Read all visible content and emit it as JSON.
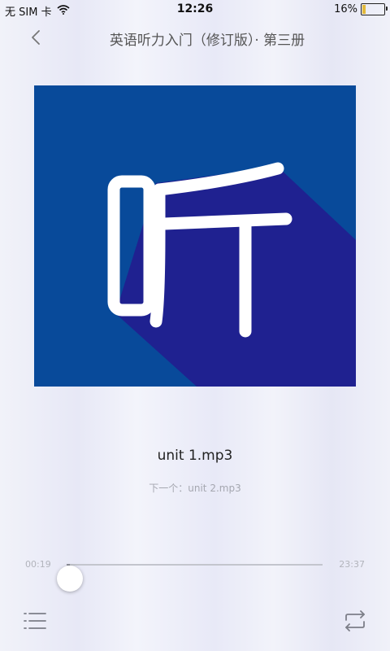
{
  "status_bar": {
    "carrier": "无 SIM 卡",
    "time": "12:26",
    "battery_text": "16%",
    "battery_level": 0.16,
    "battery_color": "#e2b93b"
  },
  "nav": {
    "back_icon": "chevron-left-icon",
    "title": "英语听力入门（修订版）· 第三册"
  },
  "album": {
    "glyph": "听",
    "background_color": "#084a9a",
    "shadow_color": "#1f2190"
  },
  "player": {
    "track_title": "unit 1.mp3",
    "next_track": "下一个：unit 2.mp3",
    "current_time": "00:19",
    "total_time": "23:37",
    "progress": 0.013
  },
  "controls": {
    "playlist_icon": "playlist-icon",
    "repeat_icon": "repeat-icon"
  }
}
